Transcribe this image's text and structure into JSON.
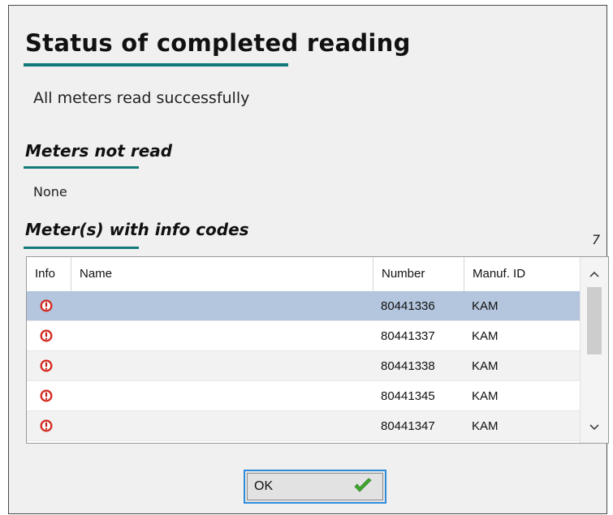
{
  "dialog": {
    "title": "Status of completed reading",
    "status_message": "All meters read successfully"
  },
  "meters_not_read": {
    "heading": "Meters not read",
    "value": "None"
  },
  "meters_info_codes": {
    "heading": "Meter(s) with info codes",
    "count": "7",
    "columns": {
      "info": "Info",
      "name": "Name",
      "number": "Number",
      "manuf_id": "Manuf. ID"
    },
    "rows": [
      {
        "info_icon": "warning-icon",
        "name": "",
        "number": "80441336",
        "manuf_id": "KAM",
        "selected": true
      },
      {
        "info_icon": "warning-icon",
        "name": "",
        "number": "80441337",
        "manuf_id": "KAM",
        "selected": false
      },
      {
        "info_icon": "warning-icon",
        "name": "",
        "number": "80441338",
        "manuf_id": "KAM",
        "selected": false
      },
      {
        "info_icon": "warning-icon",
        "name": "",
        "number": "80441345",
        "manuf_id": "KAM",
        "selected": false
      },
      {
        "info_icon": "warning-icon",
        "name": "",
        "number": "80441347",
        "manuf_id": "KAM",
        "selected": false
      }
    ]
  },
  "ok_button": {
    "label": "OK",
    "icon": "check-icon"
  },
  "colors": {
    "accent": "#127a78",
    "selected_row": "#b4c6de",
    "warning": "#d42a1e",
    "check": "#3fa92f",
    "focus_border": "#2f8bdc"
  }
}
